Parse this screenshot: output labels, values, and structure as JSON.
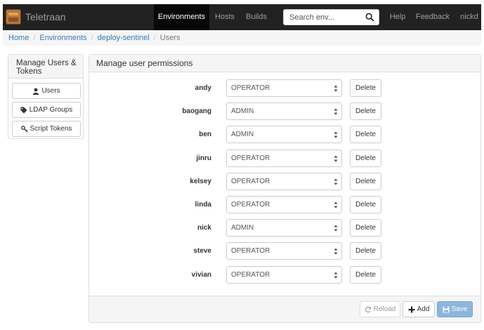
{
  "app": {
    "title": "Teletraan"
  },
  "nav": {
    "items": [
      {
        "label": "Environments",
        "active": true
      },
      {
        "label": "Hosts",
        "active": false
      },
      {
        "label": "Builds",
        "active": false
      }
    ],
    "search_placeholder": "Search env...",
    "help": "Help",
    "feedback": "Feedback",
    "user": "nickd"
  },
  "breadcrumb": {
    "items": [
      "Home",
      "Environments",
      "deploy-sentinel"
    ],
    "current": "Users",
    "separator": "/"
  },
  "sidebar": {
    "heading": "Manage Users & Tokens",
    "buttons": [
      {
        "label": "Users",
        "icon": "user-icon"
      },
      {
        "label": "LDAP Groups",
        "icon": "tag-icon"
      },
      {
        "label": "Script Tokens",
        "icon": "key-icon"
      }
    ]
  },
  "main": {
    "heading": "Manage user permissions",
    "delete_label": "Delete",
    "users": [
      {
        "name": "andy",
        "role": "OPERATOR"
      },
      {
        "name": "baogang",
        "role": "ADMIN"
      },
      {
        "name": "ben",
        "role": "ADMIN"
      },
      {
        "name": "jinru",
        "role": "OPERATOR"
      },
      {
        "name": "kelsey",
        "role": "OPERATOR"
      },
      {
        "name": "linda",
        "role": "OPERATOR"
      },
      {
        "name": "nick",
        "role": "ADMIN"
      },
      {
        "name": "steve",
        "role": "OPERATOR"
      },
      {
        "name": "vivian",
        "role": "OPERATOR"
      }
    ],
    "footer": {
      "reload": "Reload",
      "add": "Add",
      "save": "Save"
    }
  },
  "colors": {
    "navbar": "#222222",
    "link": "#337ab7",
    "save_button": "#8cb5de"
  }
}
